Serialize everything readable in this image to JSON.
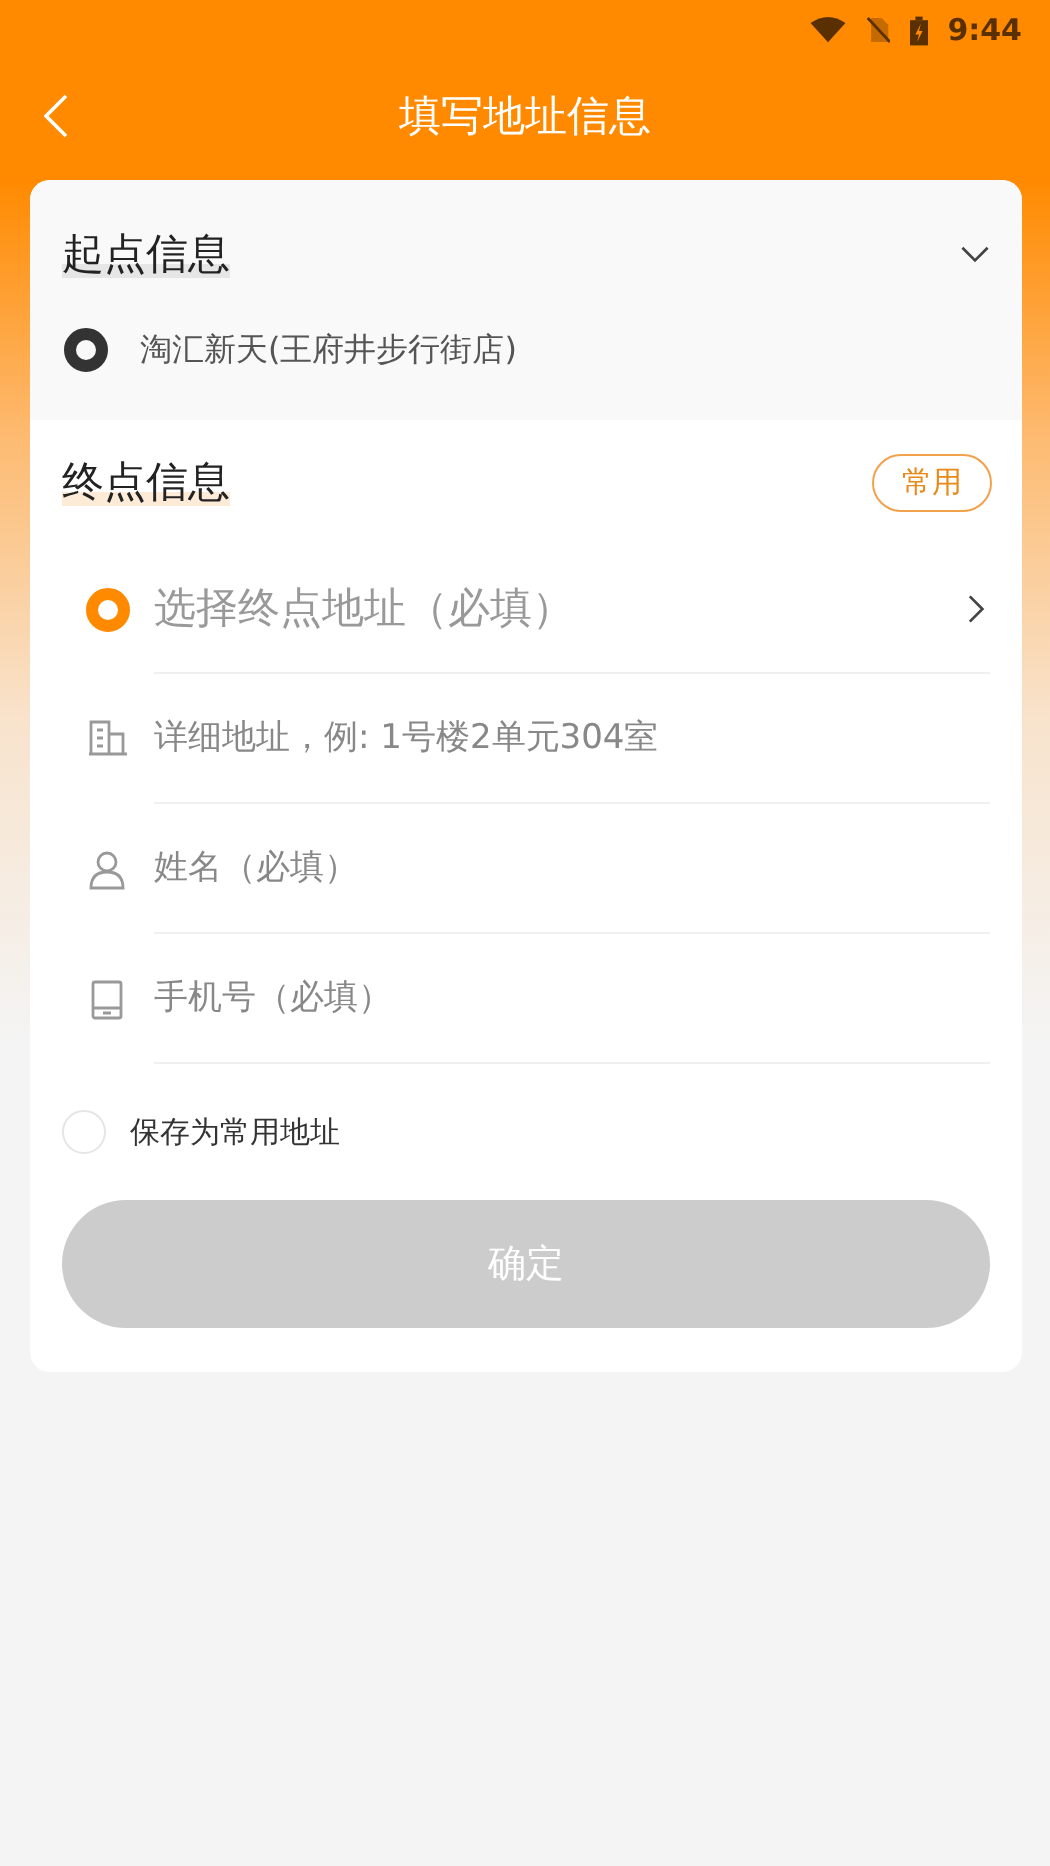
{
  "status_bar": {
    "time": "9:44"
  },
  "title": "填写地址信息",
  "start": {
    "heading": "起点信息",
    "address": "淘汇新天(王府井步行街店)"
  },
  "end": {
    "heading": "终点信息",
    "frequent_button": "常用",
    "fields": [
      {
        "kind": "select",
        "placeholder": "选择终点地址（必填）"
      },
      {
        "kind": "building",
        "placeholder": "详细地址，例: 1号楼2单元304室"
      },
      {
        "kind": "person",
        "placeholder": "姓名（必填）"
      },
      {
        "kind": "phone",
        "placeholder": "手机号（必填）"
      }
    ]
  },
  "save_as_frequent": {
    "label": "保存为常用地址",
    "checked": false
  },
  "confirm": {
    "label": "确定",
    "disabled": true
  }
}
